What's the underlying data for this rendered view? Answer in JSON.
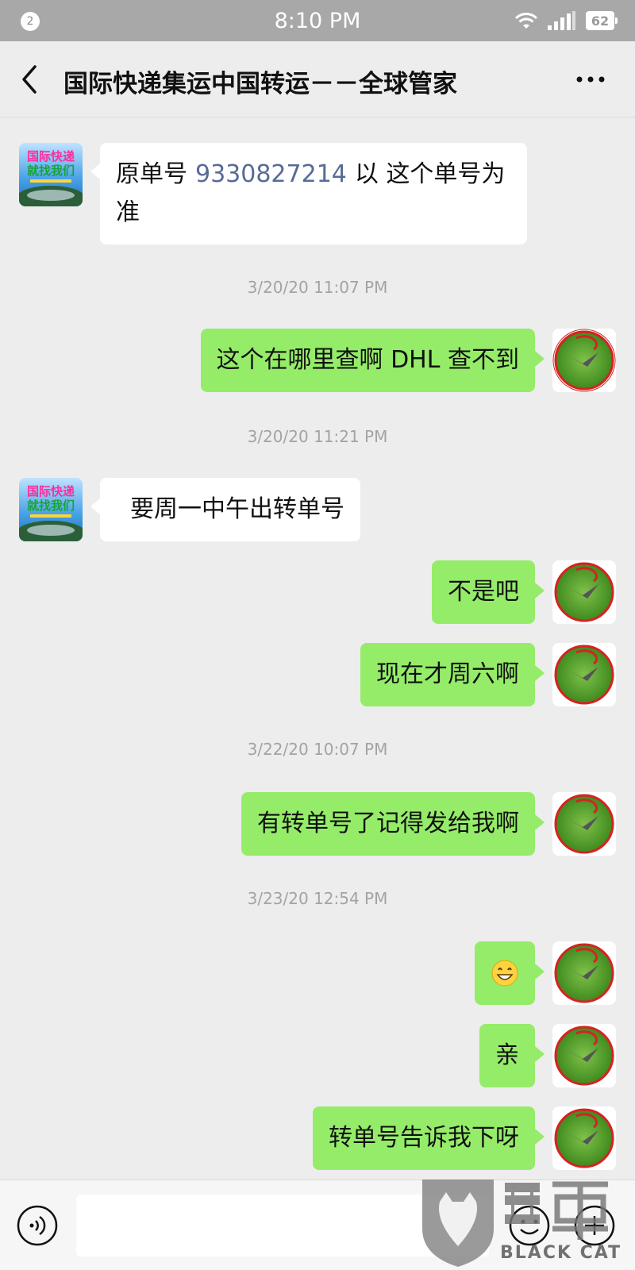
{
  "status_bar": {
    "notification_count": "2",
    "time": "8:10 PM",
    "battery": "62"
  },
  "header": {
    "title": "国际快递集运中国转运－－全球管家"
  },
  "messages": {
    "m1": {
      "prefix": "原单号",
      "number": "9330827214",
      "suffix": "以 这个单号为准"
    },
    "ts1": "3/20/20 11:07 PM",
    "m2": "这个在哪里查啊 DHL 查不到",
    "ts2": "3/20/20 11:21 PM",
    "m3": "要周一中午出转单号",
    "m4": "不是吧",
    "m5": "现在才周六啊",
    "ts3": "3/22/20 10:07 PM",
    "m6": "有转单号了记得发给我啊",
    "ts4": "3/23/20 12:54 PM",
    "m7_icon": "grinning-emoji",
    "m8": "亲",
    "m9": "转单号告诉我下呀"
  },
  "avatars": {
    "contact_logo_text": [
      "国际快递",
      "就找我们"
    ]
  },
  "watermark": {
    "text": "BLACK CAT"
  },
  "colors": {
    "status_bar": "#a8a8a8",
    "background": "#ededed",
    "bubble_sent": "#95ec69",
    "bubble_received": "#ffffff",
    "link_number": "#576b95"
  }
}
